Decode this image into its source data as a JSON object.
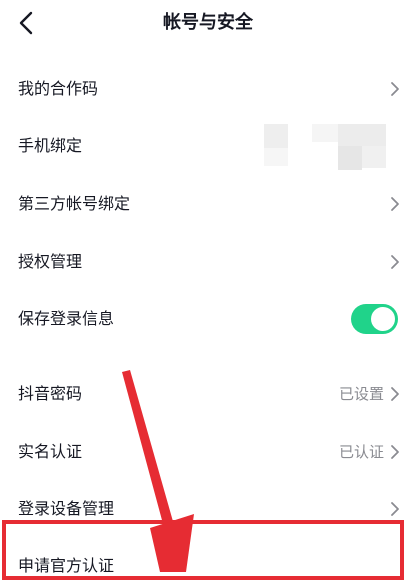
{
  "header": {
    "title": "帐号与安全"
  },
  "settings": {
    "rows": [
      {
        "label": "我的合作码"
      },
      {
        "label": "手机绑定"
      },
      {
        "label": "第三方帐号绑定"
      },
      {
        "label": "授权管理"
      },
      {
        "label": "保存登录信息",
        "toggle_on": true
      },
      {
        "label": "抖音密码",
        "value": "已设置"
      },
      {
        "label": "实名认证",
        "value": "已认证"
      },
      {
        "label": "登录设备管理"
      },
      {
        "label": "申请官方认证"
      }
    ]
  },
  "colors": {
    "toggle_on": "#20d38a",
    "annotation_red": "#e62c33",
    "secondary_text": "#8a8b91"
  }
}
